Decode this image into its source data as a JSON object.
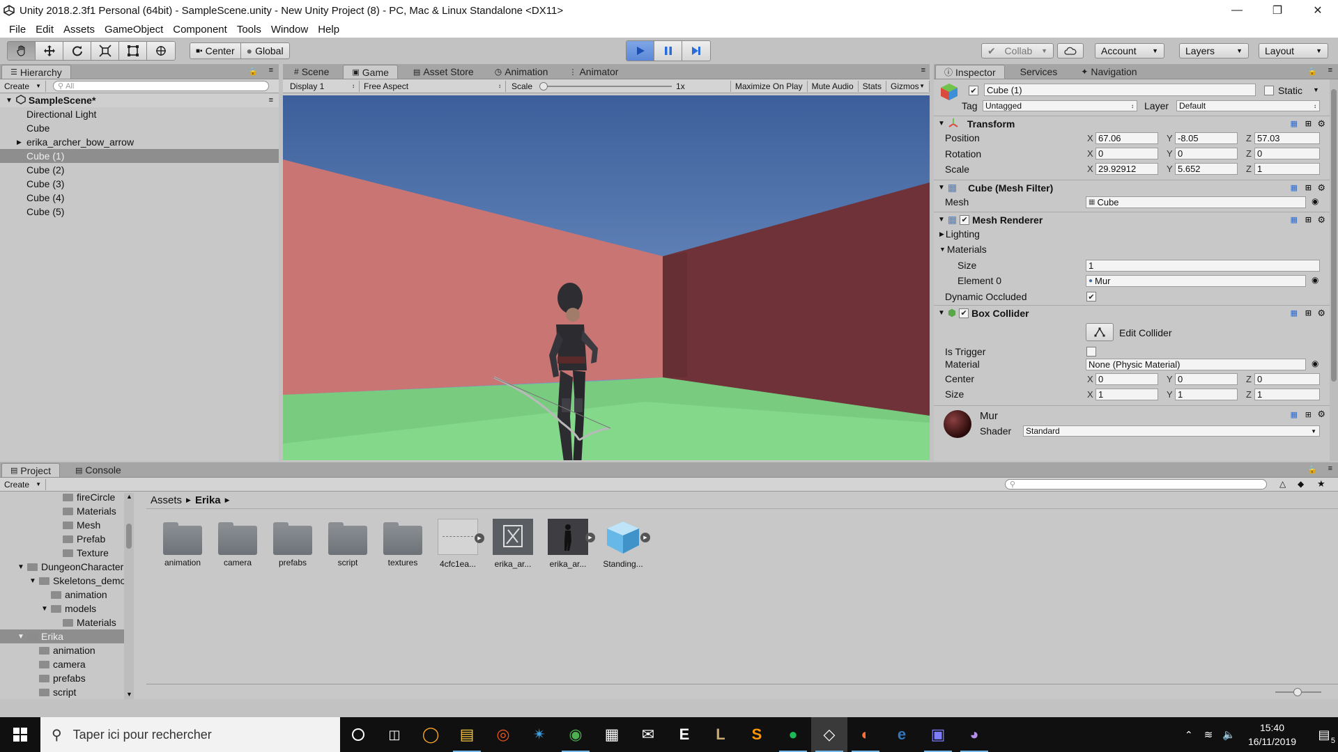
{
  "window": {
    "title": "Unity 2018.2.3f1 Personal (64bit) - SampleScene.unity - New Unity Project (8) - PC, Mac & Linux Standalone <DX11>"
  },
  "menu": [
    "File",
    "Edit",
    "Assets",
    "GameObject",
    "Component",
    "Tools",
    "Window",
    "Help"
  ],
  "toolbar": {
    "pivot": "Center",
    "space": "Global",
    "collab": "Collab",
    "account": "Account",
    "layers": "Layers",
    "layout": "Layout",
    "play_state": "playing"
  },
  "hierarchy": {
    "tab": "Hierarchy",
    "create": "Create",
    "search_placeholder": "All",
    "scene": "SampleScene*",
    "items": [
      {
        "label": "Directional Light",
        "selected": false,
        "expandable": false
      },
      {
        "label": "Cube",
        "selected": false,
        "expandable": false
      },
      {
        "label": "erika_archer_bow_arrow",
        "selected": false,
        "expandable": true
      },
      {
        "label": "Cube (1)",
        "selected": true,
        "expandable": false
      },
      {
        "label": "Cube (2)",
        "selected": false,
        "expandable": false
      },
      {
        "label": "Cube (3)",
        "selected": false,
        "expandable": false
      },
      {
        "label": "Cube (4)",
        "selected": false,
        "expandable": false
      },
      {
        "label": "Cube (5)",
        "selected": false,
        "expandable": false
      }
    ]
  },
  "view_tabs": {
    "scene": "Scene",
    "game": "Game",
    "asset_store": "Asset Store",
    "animation": "Animation",
    "animator": "Animator"
  },
  "game_bar": {
    "display": "Display 1",
    "aspect": "Free Aspect",
    "scale_label": "Scale",
    "scale_value": "1x",
    "maximize": "Maximize On Play",
    "mute": "Mute Audio",
    "stats": "Stats",
    "gizmos": "Gizmos"
  },
  "inspector": {
    "tabs": {
      "inspector": "Inspector",
      "services": "Services",
      "navigation": "Navigation"
    },
    "object_name": "Cube (1)",
    "static_label": "Static",
    "tag_label": "Tag",
    "tag_value": "Untagged",
    "layer_label": "Layer",
    "layer_value": "Default",
    "transform": {
      "title": "Transform",
      "position_label": "Position",
      "position": {
        "x": "67.06",
        "y": "-8.05",
        "z": "57.03"
      },
      "rotation_label": "Rotation",
      "rotation": {
        "x": "0",
        "y": "0",
        "z": "0"
      },
      "scale_label": "Scale",
      "scale": {
        "x": "29.92912",
        "y": "5.652",
        "z": "1"
      }
    },
    "mesh_filter": {
      "title": "Cube (Mesh Filter)",
      "mesh_label": "Mesh",
      "mesh_value": "Cube"
    },
    "mesh_renderer": {
      "title": "Mesh Renderer",
      "lighting": "Lighting",
      "materials": "Materials",
      "size_label": "Size",
      "size_value": "1",
      "element_label": "Element 0",
      "element_value": "Mur",
      "dynamic_occluded": "Dynamic Occluded"
    },
    "box_collider": {
      "title": "Box Collider",
      "edit_collider": "Edit Collider",
      "is_trigger": "Is Trigger",
      "material_label": "Material",
      "material_value": "None (Physic Material)",
      "center_label": "Center",
      "center": {
        "x": "0",
        "y": "0",
        "z": "0"
      },
      "size_label": "Size",
      "size": {
        "x": "1",
        "y": "1",
        "z": "1"
      }
    },
    "material": {
      "name": "Mur",
      "shader_label": "Shader",
      "shader_value": "Standard"
    }
  },
  "project": {
    "tabs": {
      "project": "Project",
      "console": "Console"
    },
    "create": "Create",
    "tree": [
      {
        "label": "fireCircle",
        "indent": 4,
        "arrow": ""
      },
      {
        "label": "Materials",
        "indent": 4,
        "arrow": ""
      },
      {
        "label": "Mesh",
        "indent": 4,
        "arrow": ""
      },
      {
        "label": "Prefab",
        "indent": 4,
        "arrow": ""
      },
      {
        "label": "Texture",
        "indent": 4,
        "arrow": ""
      },
      {
        "label": "DungeonCharacter",
        "indent": 1,
        "arrow": "▼"
      },
      {
        "label": "Skeletons_demo",
        "indent": 2,
        "arrow": "▼"
      },
      {
        "label": "animation",
        "indent": 3,
        "arrow": ""
      },
      {
        "label": "models",
        "indent": 3,
        "arrow": "▼"
      },
      {
        "label": "Materials",
        "indent": 4,
        "arrow": ""
      },
      {
        "label": "Erika",
        "indent": 1,
        "arrow": "▼",
        "selected": true
      },
      {
        "label": "animation",
        "indent": 2,
        "arrow": ""
      },
      {
        "label": "camera",
        "indent": 2,
        "arrow": ""
      },
      {
        "label": "prefabs",
        "indent": 2,
        "arrow": ""
      },
      {
        "label": "script",
        "indent": 2,
        "arrow": ""
      }
    ],
    "breadcrumb": {
      "root": "Assets",
      "current": "Erika"
    },
    "assets": [
      {
        "label": "animation",
        "kind": "folder"
      },
      {
        "label": "camera",
        "kind": "folder"
      },
      {
        "label": "prefabs",
        "kind": "folder"
      },
      {
        "label": "script",
        "kind": "folder"
      },
      {
        "label": "textures",
        "kind": "folder"
      },
      {
        "label": "4cfc1ea...",
        "kind": "texture"
      },
      {
        "label": "erika_ar...",
        "kind": "model-icon"
      },
      {
        "label": "erika_ar...",
        "kind": "model-preview"
      },
      {
        "label": "Standing...",
        "kind": "cube"
      }
    ]
  },
  "taskbar": {
    "search_placeholder": "Taper ici pour rechercher",
    "time": "15:40",
    "date": "16/11/2019",
    "notifications": "5",
    "apps": [
      "overwatch",
      "file-explorer",
      "ubuntu",
      "battlenet",
      "chrome",
      "store",
      "mail",
      "epic-games",
      "league",
      "sublime-text",
      "spotify",
      "unity",
      "firefox",
      "edge",
      "messenger",
      "github-desktop"
    ]
  },
  "colors": {
    "left_wall": "#c97574",
    "right_wall": "#6e3238",
    "floor": "#84d889",
    "sky_top": "#3c5f9b",
    "sky_bottom": "#7d9ed1",
    "accent": "#2a6cd8"
  }
}
